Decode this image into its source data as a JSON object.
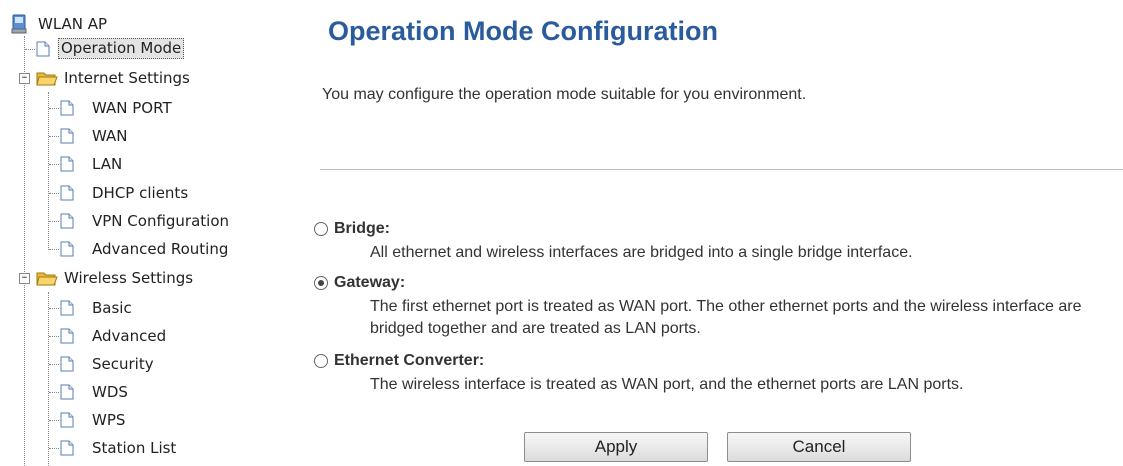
{
  "tree": {
    "root": "WLAN AP",
    "operation_mode": "Operation Mode",
    "internet_settings": {
      "label": "Internet Settings",
      "expander": "−",
      "items": [
        "WAN PORT",
        "WAN",
        "LAN",
        "DHCP clients",
        "VPN Configuration",
        "Advanced Routing"
      ]
    },
    "wireless_settings": {
      "label": "Wireless Settings",
      "expander": "−",
      "items": [
        "Basic",
        "Advanced",
        "Security",
        "WDS",
        "WPS",
        "Station List"
      ]
    }
  },
  "main": {
    "title": "Operation Mode Configuration",
    "intro": "You may configure the operation mode suitable for you environment.",
    "options": [
      {
        "name": "Bridge:",
        "desc": "All ethernet and wireless interfaces are bridged into a single bridge interface.",
        "checked": false
      },
      {
        "name": "Gateway:",
        "desc": "The first ethernet port is treated as WAN port. The other ethernet ports and the wireless interface are bridged together and are treated as LAN ports.",
        "checked": true
      },
      {
        "name": "Ethernet Converter:",
        "desc": "The wireless interface is treated as WAN port, and the ethernet ports are LAN ports.",
        "checked": false
      }
    ],
    "apply_label": "Apply",
    "cancel_label": "Cancel"
  },
  "colors": {
    "title": "#2a5b9c",
    "folder": "#f2c94c"
  }
}
